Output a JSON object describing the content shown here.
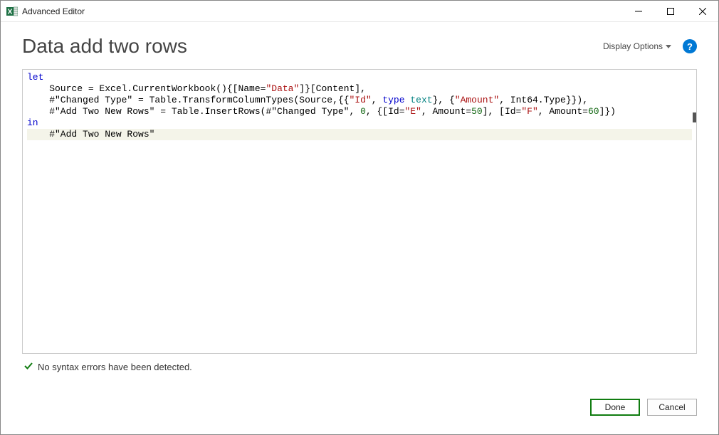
{
  "window": {
    "title": "Advanced Editor"
  },
  "header": {
    "page_title": "Data add two rows",
    "display_options_label": "Display Options",
    "help_char": "?"
  },
  "code_tokens": {
    "let": "let",
    "in": "in",
    "type": "type",
    "text": "text",
    "line2_pre": "    Source = Excel.CurrentWorkbook(){[Name=",
    "line2_str": "\"Data\"",
    "line2_post": "]}[Content],",
    "line3_pre": "    #\"Changed Type\" = Table.TransformColumnTypes(Source,{{",
    "line3_id": "\"Id\"",
    "line3_mid1": ", ",
    "line3_mid2": "}, {",
    "line3_amount": "\"Amount\"",
    "line3_post": ", Int64.Type}}),",
    "line4_pre": "    #\"Add Two New Rows\" = Table.InsertRows(#\"Changed Type\", ",
    "line4_zero": "0",
    "line4_mid1": ", {[Id=",
    "line4_e": "\"E\"",
    "line4_mid2": ", Amount=",
    "line4_50": "50",
    "line4_mid3": "], [Id=",
    "line4_f": "\"F\"",
    "line4_mid4": ", Amount=",
    "line4_60": "60",
    "line4_post": "]})",
    "line6": "    #\"Add Two New Rows\""
  },
  "status": {
    "message": "No syntax errors have been detected."
  },
  "footer": {
    "done": "Done",
    "cancel": "Cancel"
  }
}
